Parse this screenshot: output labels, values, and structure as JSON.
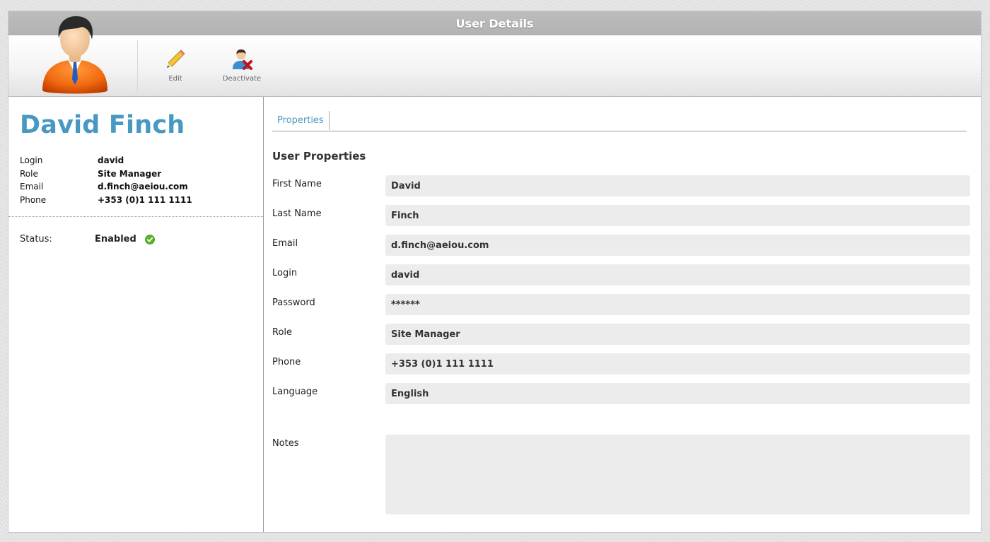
{
  "window": {
    "title": "User Details"
  },
  "toolbar": {
    "edit_label": "Edit",
    "deactivate_label": "Deactivate"
  },
  "user": {
    "name": "David Finch",
    "summary": [
      {
        "label": "Login",
        "value": "david"
      },
      {
        "label": "Role",
        "value": "Site Manager"
      },
      {
        "label": "Email",
        "value": "d.finch@aeiou.com"
      },
      {
        "label": "Phone",
        "value": "+353 (0)1 111 1111"
      }
    ],
    "status_label": "Status:",
    "status_value": "Enabled"
  },
  "tabs": [
    {
      "label": "Properties"
    }
  ],
  "properties": {
    "title": "User Properties",
    "fields": [
      {
        "label": "First Name",
        "value": "David"
      },
      {
        "label": "Last Name",
        "value": "Finch"
      },
      {
        "label": "Email",
        "value": "d.finch@aeiou.com"
      },
      {
        "label": "Login",
        "value": "david"
      },
      {
        "label": "Password",
        "value": "******"
      },
      {
        "label": "Role",
        "value": "Site Manager"
      },
      {
        "label": "Phone",
        "value": "+353 (0)1 111 1111"
      },
      {
        "label": "Language",
        "value": "English"
      }
    ],
    "notes_label": "Notes",
    "notes_value": ""
  },
  "icons": {
    "avatar": "user-avatar-icon",
    "edit": "pencil-icon",
    "deactivate": "user-remove-icon",
    "status": "check-circle-icon"
  },
  "colors": {
    "accent": "#4799c2",
    "titlebar": "#b7b7b7",
    "field_bg": "#ececec",
    "status_ok": "#5cb531"
  }
}
